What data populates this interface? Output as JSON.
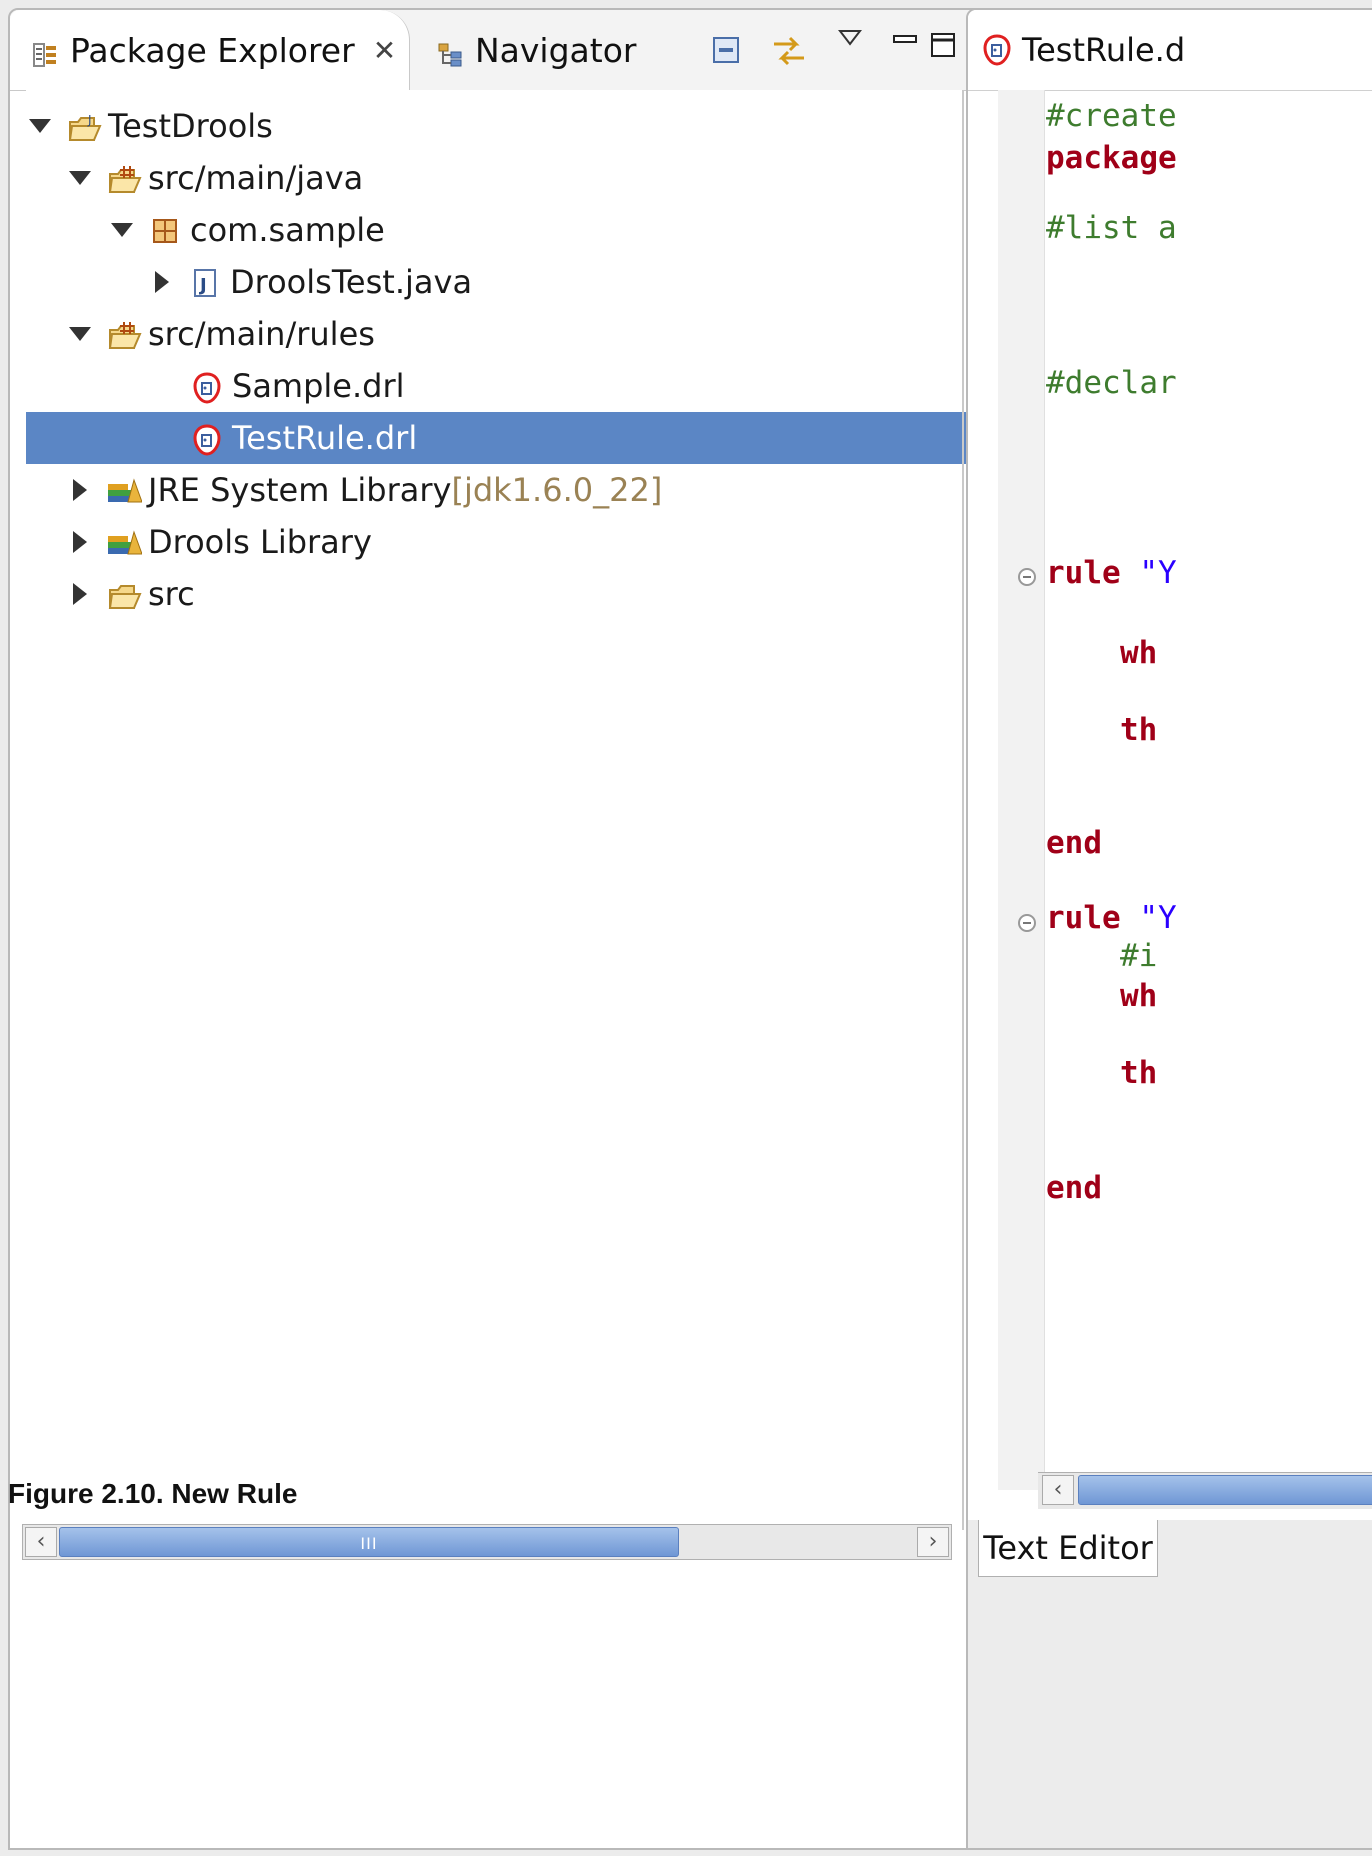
{
  "left_view": {
    "tabs": [
      {
        "label": "Package Explorer",
        "active": true,
        "icon": "package-explorer-icon"
      },
      {
        "label": "Navigator",
        "active": false,
        "icon": "navigator-icon"
      }
    ],
    "toolbar_icons": [
      "collapse-all-icon",
      "link-with-editor-icon",
      "view-menu-icon",
      "minimize-icon",
      "maximize-icon"
    ],
    "tree": [
      {
        "label": "TestDrools",
        "decoration": "",
        "level": 0,
        "expanded": true,
        "icon": "java-project-icon"
      },
      {
        "label": "src/main/java",
        "decoration": "",
        "level": 1,
        "expanded": true,
        "icon": "source-folder-icon"
      },
      {
        "label": "com.sample",
        "decoration": "",
        "level": 2,
        "expanded": true,
        "icon": "package-icon"
      },
      {
        "label": "DroolsTest.java",
        "decoration": "",
        "level": 3,
        "expanded": false,
        "icon": "java-file-icon"
      },
      {
        "label": "src/main/rules",
        "decoration": "",
        "level": 1,
        "expanded": true,
        "icon": "source-folder-icon"
      },
      {
        "label": "Sample.drl",
        "decoration": "",
        "level": 2,
        "icon": "drools-file-icon"
      },
      {
        "label": "TestRule.drl",
        "decoration": "",
        "level": 2,
        "icon": "drools-file-icon",
        "selected": true
      },
      {
        "label": "JRE System Library ",
        "decoration": "[jdk1.6.0_22]",
        "level": 1,
        "expanded": false,
        "icon": "library-icon"
      },
      {
        "label": "Drools Library",
        "decoration": "",
        "level": 1,
        "expanded": false,
        "icon": "library-icon"
      },
      {
        "label": "src",
        "decoration": "",
        "level": 1,
        "expanded": false,
        "icon": "folder-icon"
      }
    ],
    "scroll": {
      "grip": "III"
    }
  },
  "caption": "Figure 2.10. New Rule",
  "editor": {
    "tab_label": "TestRule.d",
    "bottom_tab": "Text Editor",
    "lines": [
      {
        "text": "#create",
        "cls": "comment"
      },
      {
        "text": "package",
        "cls": "keyword"
      },
      {
        "text": "#list a",
        "cls": "comment"
      },
      {
        "text": "#declar",
        "cls": "comment"
      },
      {
        "text": "rule ",
        "cls": "keyword",
        "extra": "\"Y",
        "fold": true
      },
      {
        "text": "wh",
        "cls": "keyword",
        "indent": true
      },
      {
        "text": "th",
        "cls": "keyword",
        "indent": true
      },
      {
        "text": "end",
        "cls": "keyword"
      },
      {
        "text": "rule ",
        "cls": "keyword",
        "extra": "\"Y",
        "fold": true
      },
      {
        "text": "#i",
        "cls": "comment",
        "indent": true
      },
      {
        "text": "wh",
        "cls": "keyword",
        "indent": true
      },
      {
        "text": "th",
        "cls": "keyword",
        "indent": true
      },
      {
        "text": "end",
        "cls": "keyword"
      }
    ]
  },
  "colors": {
    "selection": "#5b86c5",
    "keyword": "#a00018",
    "comment": "#3e7c2e"
  }
}
